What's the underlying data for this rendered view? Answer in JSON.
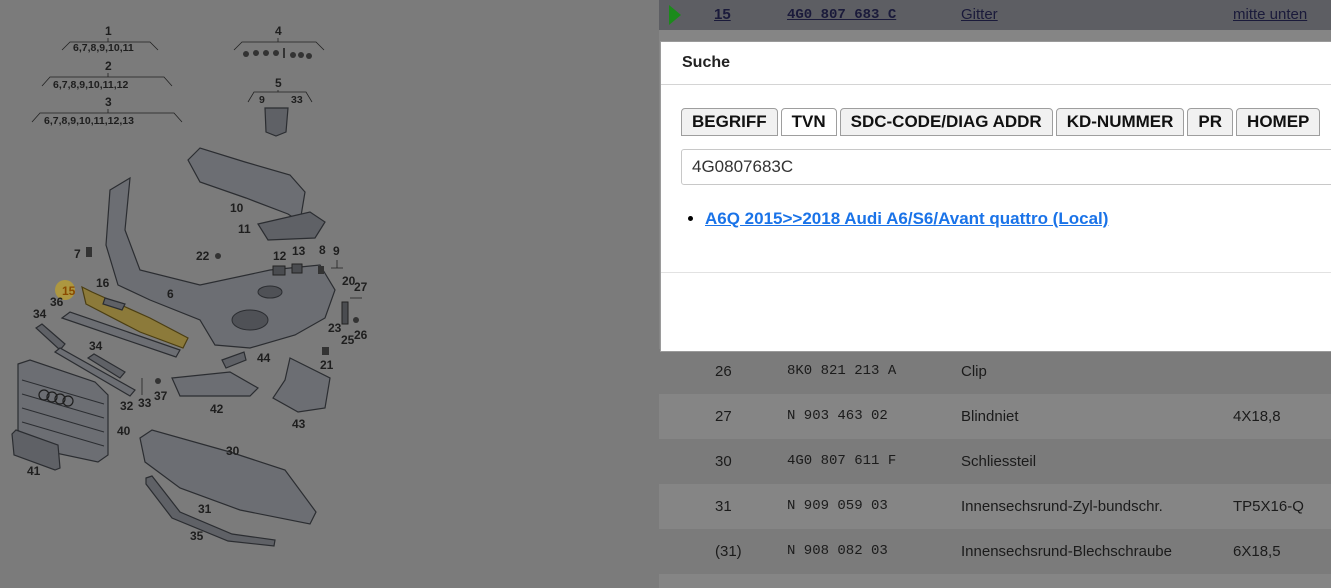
{
  "diagram": {
    "callouts": [
      "1",
      "2",
      "3",
      "4",
      "5",
      "6",
      "7",
      "8",
      "9",
      "10",
      "11",
      "12",
      "13",
      "15",
      "16",
      "20",
      "21",
      "22",
      "23",
      "25",
      "26",
      "27",
      "30",
      "31",
      "32",
      "33",
      "34",
      "34",
      "35",
      "36",
      "37",
      "40",
      "41",
      "42",
      "43",
      "44"
    ],
    "sub_lists": {
      "one": "6,7,8,9,10,11",
      "two": "6,7,8,9,10,11,12",
      "three": "6,7,8,9,10,11,12,13",
      "five_a": "9",
      "five_b": "33"
    },
    "highlighted_callout": "15",
    "highlight_color": "#b39a3a"
  },
  "selected_row": {
    "pos": "15",
    "tvn": "4G0 807 683 C",
    "description": "Gitter",
    "note": "mitte unten"
  },
  "rows": [
    {
      "pos": "26",
      "tvn": "8K0 821 213 A",
      "description": "Clip",
      "note": ""
    },
    {
      "pos": "27",
      "tvn": "N   903 463 02",
      "description": "Blindniet",
      "note": "4X18,8"
    },
    {
      "pos": "30",
      "tvn": "4G0 807 611 F",
      "description": "Schliessteil",
      "note": ""
    },
    {
      "pos": "31",
      "tvn": "N   909 059 03",
      "description": "Innensechsrund-Zyl-bundschr.",
      "note": "TP5X16-Q"
    },
    {
      "pos": "(31)",
      "tvn": "N   908 082 03",
      "description": "Innensechsrund-Blechschraube",
      "note": "6X18,5"
    }
  ],
  "modal": {
    "title": "Suche",
    "tabs": [
      "BEGRIFF",
      "TVN",
      "SDC-CODE/DIAG ADDR",
      "KD-NUMMER",
      "PR",
      "HOMEP"
    ],
    "active_tab": "TVN",
    "search_value": "4G0807683C",
    "results": [
      "A6Q 2015>>2018 Audi A6/S6/Avant quattro (Local)"
    ]
  },
  "colors": {
    "link": "#1a73e8",
    "play_icon": "#1b8a1b"
  }
}
